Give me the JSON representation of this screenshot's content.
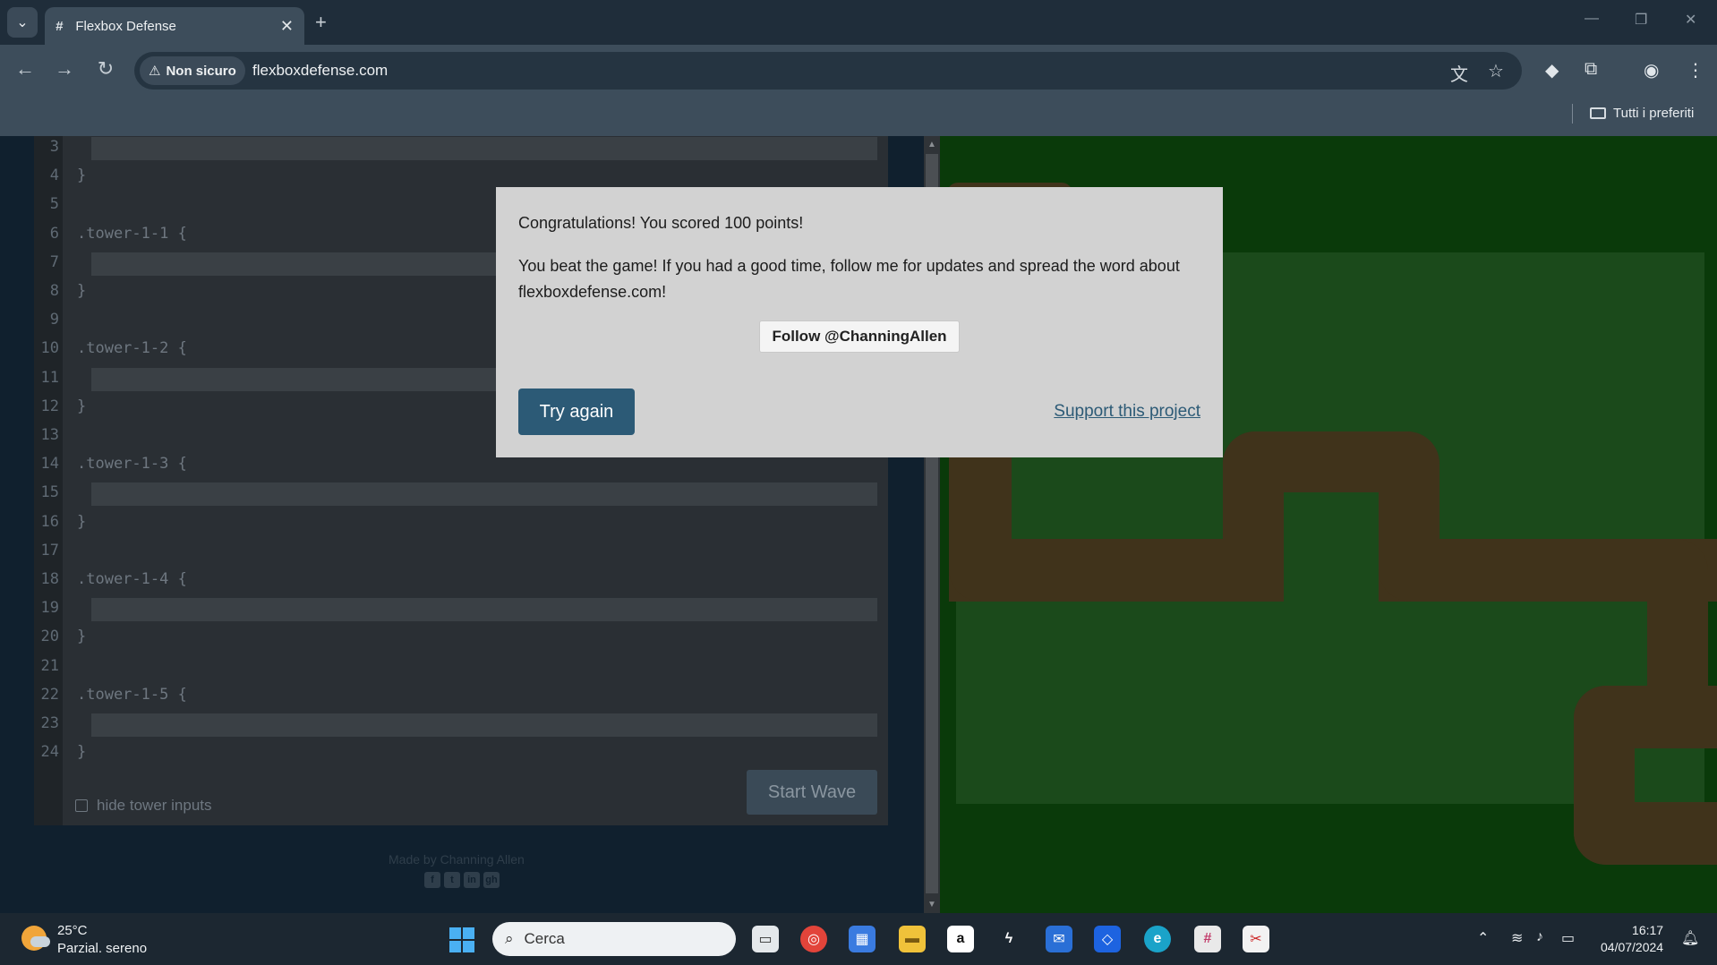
{
  "browser": {
    "tab_title": "Flexbox Defense",
    "tab_favicon": "#",
    "new_tab": "+",
    "security_chip": "Non sicuro",
    "url": "flexboxdefense.com",
    "bookmark_folder": "Tutti i preferiti"
  },
  "editor": {
    "lines": [
      {
        "n": "3",
        "text": ""
      },
      {
        "n": "4",
        "text": "}"
      },
      {
        "n": "5",
        "text": ""
      },
      {
        "n": "6",
        "text": ".tower-1-1 {"
      },
      {
        "n": "7",
        "text": ""
      },
      {
        "n": "8",
        "text": "}"
      },
      {
        "n": "9",
        "text": ""
      },
      {
        "n": "10",
        "text": ".tower-1-2 {"
      },
      {
        "n": "11",
        "text": ""
      },
      {
        "n": "12",
        "text": "}"
      },
      {
        "n": "13",
        "text": ""
      },
      {
        "n": "14",
        "text": ".tower-1-3 {"
      },
      {
        "n": "15",
        "text": ""
      },
      {
        "n": "16",
        "text": "}"
      },
      {
        "n": "17",
        "text": ""
      },
      {
        "n": "18",
        "text": ".tower-1-4 {"
      },
      {
        "n": "19",
        "text": ""
      },
      {
        "n": "20",
        "text": "}"
      },
      {
        "n": "21",
        "text": ""
      },
      {
        "n": "22",
        "text": ".tower-1-5 {"
      },
      {
        "n": "23",
        "text": ""
      },
      {
        "n": "24",
        "text": "}"
      }
    ],
    "hide_inputs_label": "hide tower inputs",
    "start_wave_label": "Start Wave",
    "credit": "Made by Channing Allen",
    "social": [
      "f",
      "t",
      "in",
      "gh"
    ]
  },
  "modal": {
    "score_text": "Congratulations! You scored 100 points!",
    "message": "You beat the game! If you had a good time, follow me for updates and spread the word about flexboxdefense.com!",
    "follow_label": "Follow @ChanningAllen",
    "try_again_label": "Try again",
    "support_label": "Support this project"
  },
  "taskbar": {
    "temperature": "25°C",
    "condition": "Parzial. sereno",
    "search_placeholder": "Cerca",
    "time": "16:17",
    "date": "04/07/2024"
  },
  "colors": {
    "accent": "#2c5a76",
    "board_green": "#0a3a0a",
    "path_brown": "#40331b"
  }
}
